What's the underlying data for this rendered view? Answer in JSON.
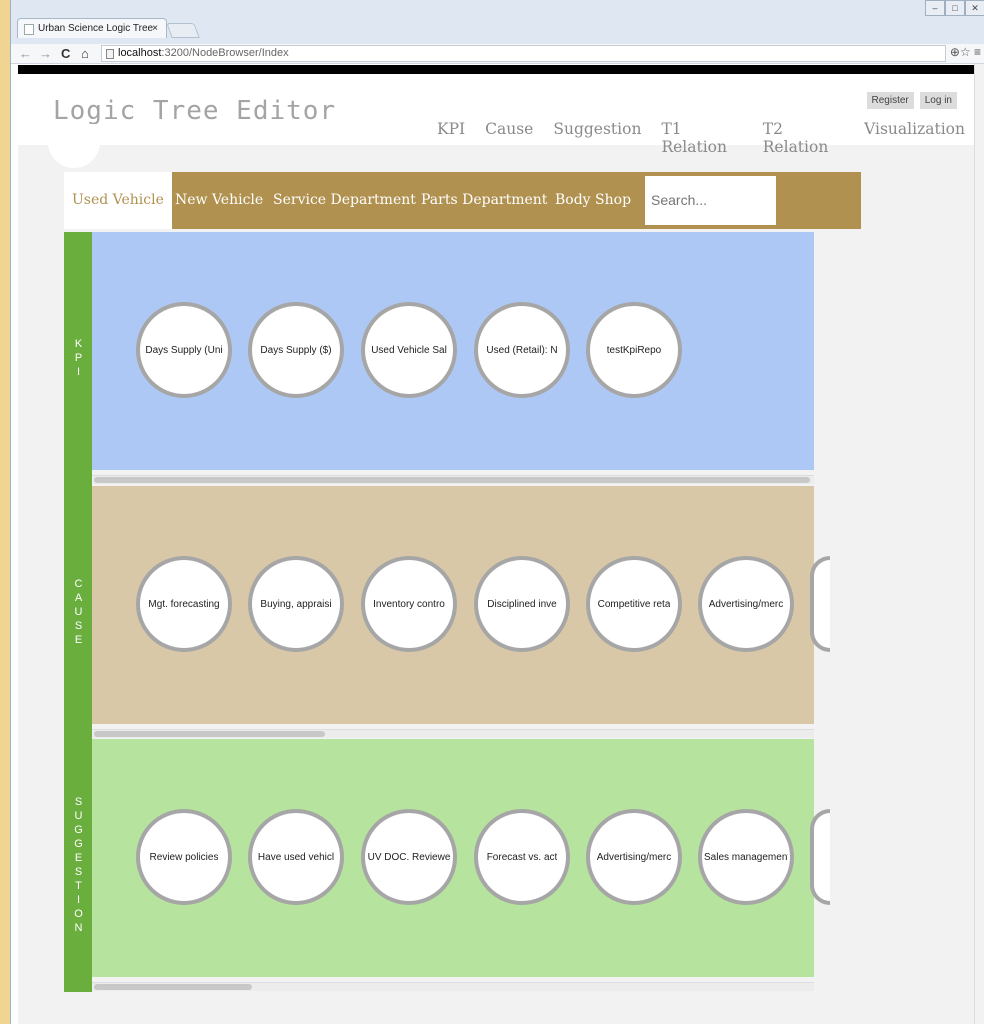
{
  "browser": {
    "tab_title": "Urban Science Logic Tree",
    "tab_close": "×",
    "nav_back": "←",
    "nav_forward": "→",
    "nav_reload": "C",
    "nav_home": "⌂",
    "url_host": "localhost",
    "url_path": ":3200/NodeBrowser/Index",
    "right_icons": "⊕☆ ≡",
    "win_min": "–",
    "win_max": "□",
    "win_close": "✕"
  },
  "header": {
    "logo": "Logic Tree Editor",
    "nav": [
      "KPI",
      "Cause",
      "Suggestion",
      "T1 Relation",
      "T2 Relation",
      "Visualization"
    ],
    "register": "Register",
    "login": "Log in"
  },
  "categories": {
    "items": [
      "Used Vehicle",
      "New Vehicle",
      "Service Department",
      "Parts Department",
      "Body Shop"
    ],
    "active_index": 0,
    "search_placeholder": "Search..."
  },
  "rows": [
    {
      "label": "KPI",
      "color": "#aec8f5",
      "nodes": [
        "Days Supply (Uni",
        "Days Supply ($)",
        "Used Vehicle Sal",
        "Used (Retail): N",
        "testKpiRepo"
      ]
    },
    {
      "label": "CAUSE",
      "color": "#d9c8a7",
      "nodes": [
        "Mgt. forecasting",
        "Buying, appraisi",
        "Inventory contro",
        "Disciplined inve",
        "Competitive reta",
        "Advertising/merc"
      ]
    },
    {
      "label": "SUGGESTION",
      "color": "#b6e39d",
      "nodes": [
        "Review policies",
        "Have used vehicl",
        "UV DOC. Reviewe",
        "Forecast vs. act",
        "Advertising/merc",
        "Sales management"
      ]
    }
  ],
  "colors": {
    "accent_bar": "#b0914f",
    "side_label": "#6aae3e",
    "node_border": "#a6a6a6"
  },
  "icons": [
    "document-icon",
    "back-arrow-icon",
    "forward-arrow-icon",
    "reload-icon",
    "home-icon",
    "page-icon",
    "zoom-icon",
    "star-icon",
    "menu-icon"
  ]
}
